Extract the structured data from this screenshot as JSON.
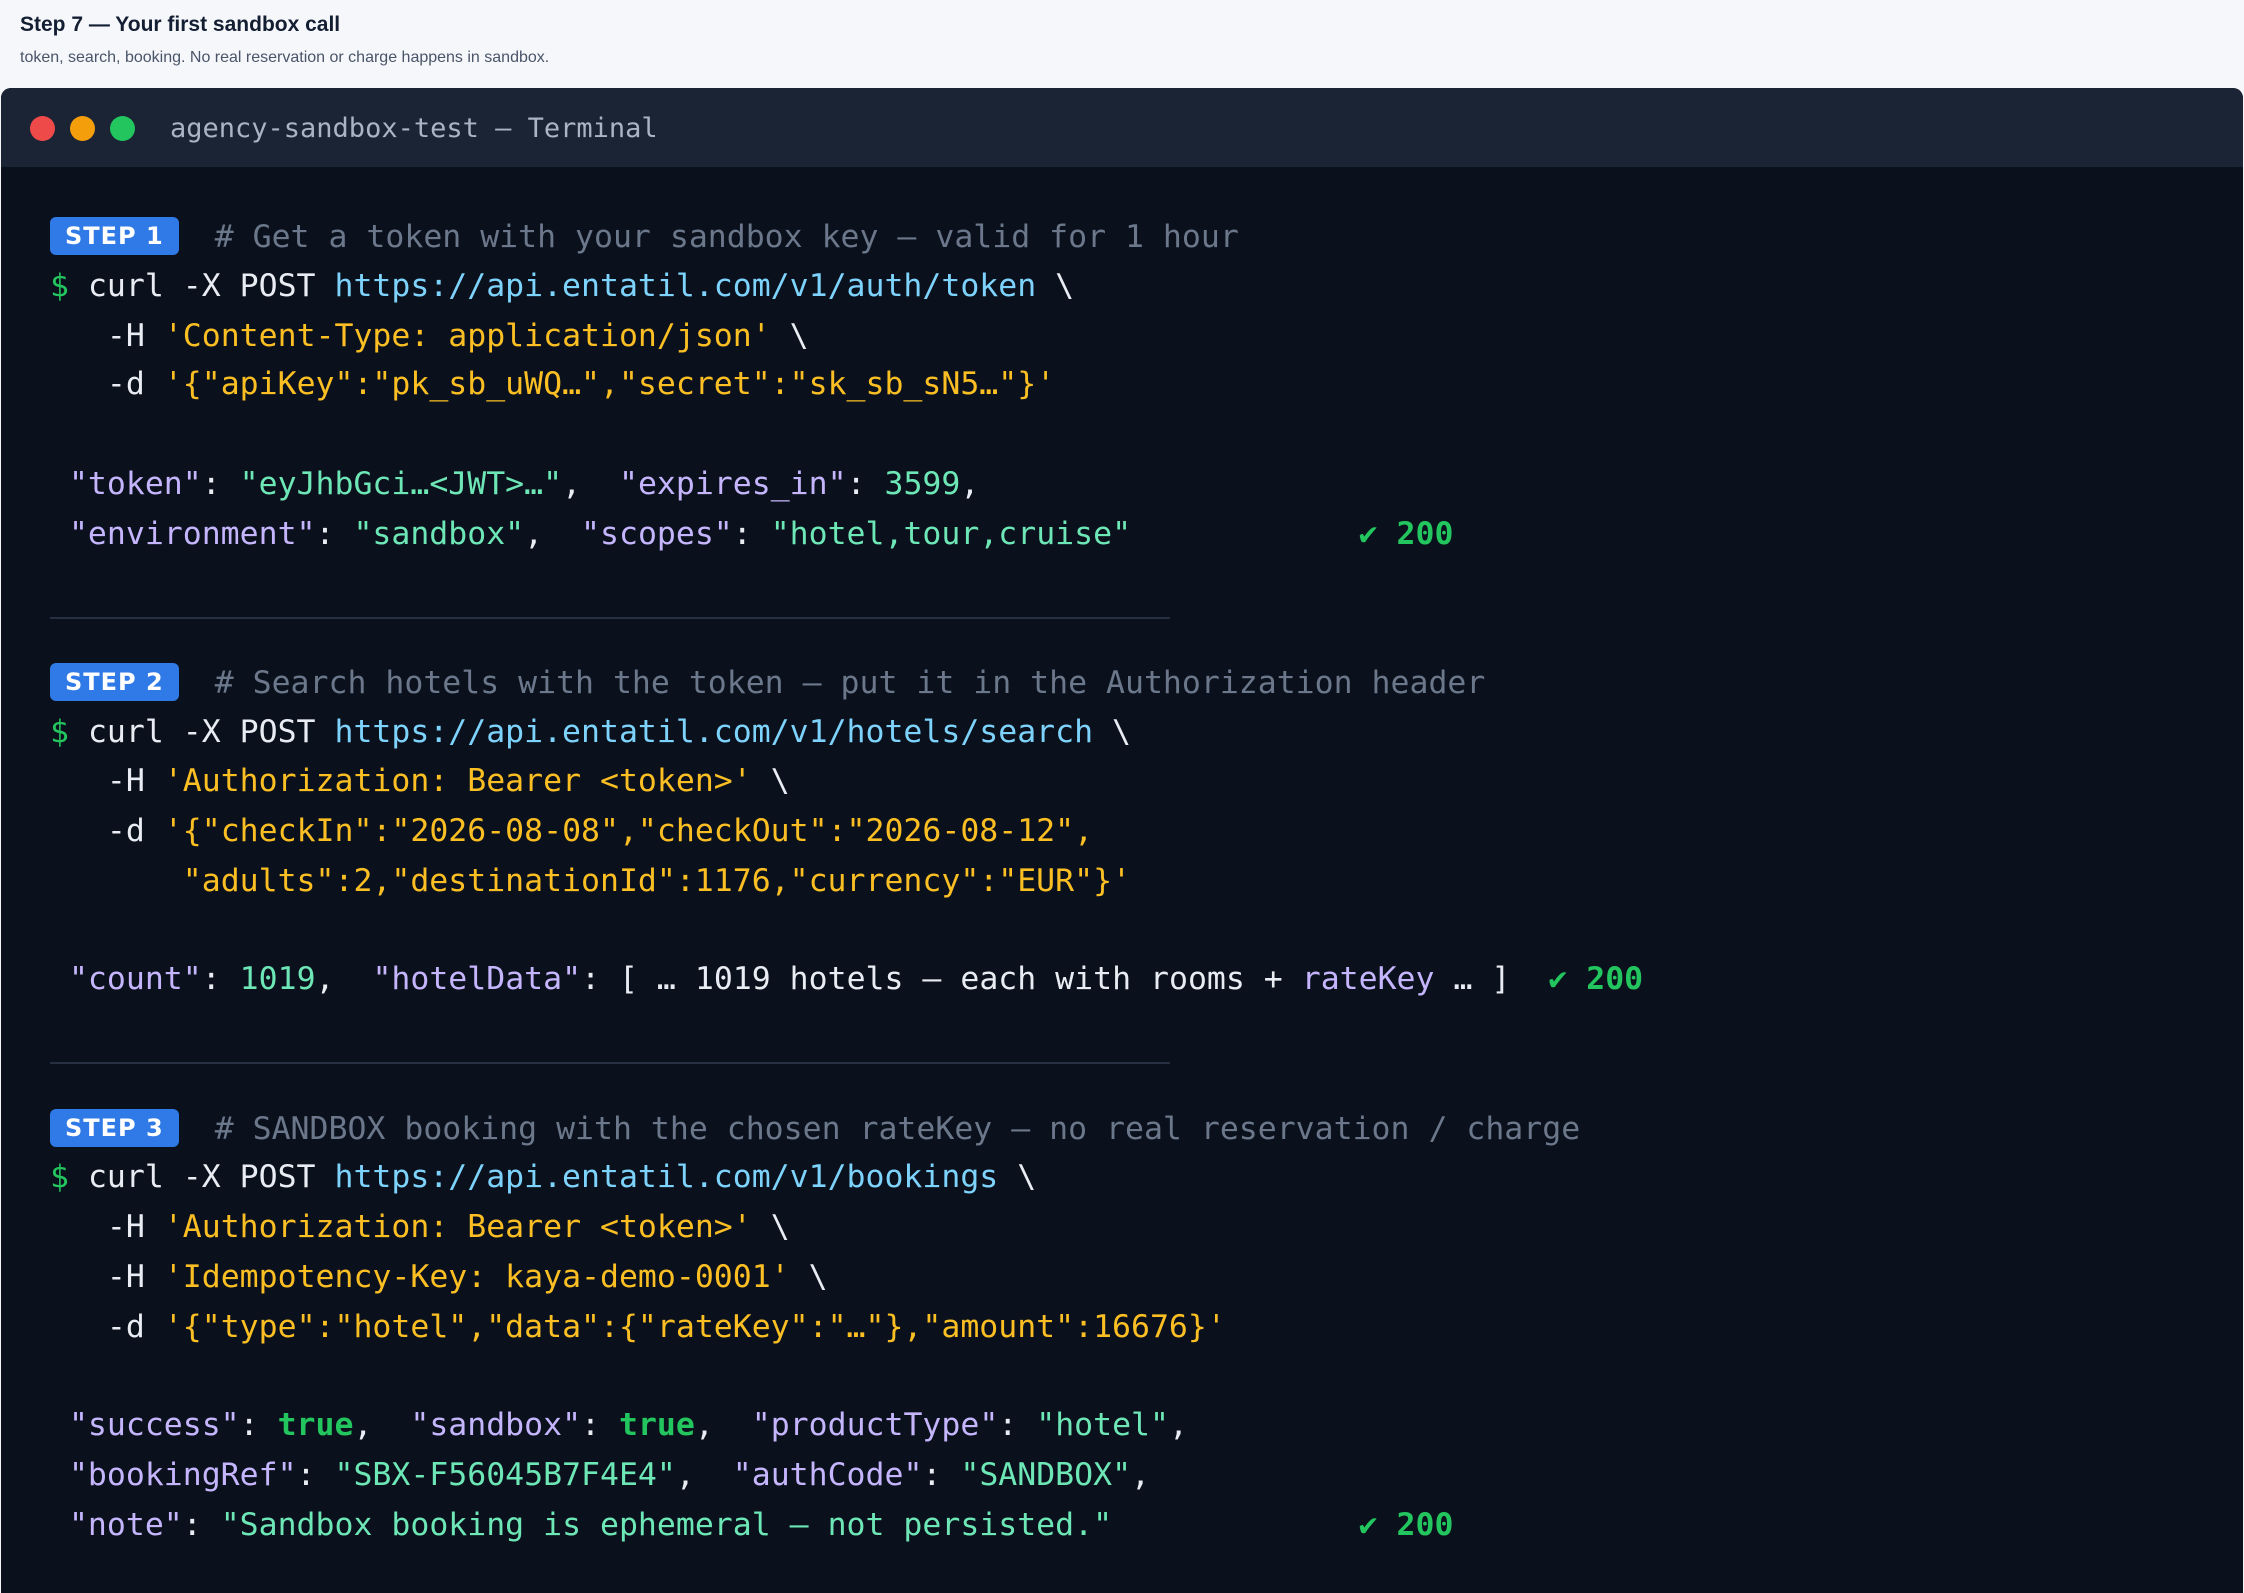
{
  "header": {
    "title": "Step 7 — Your first sandbox call",
    "subtitle": "token, search, booking. No real reservation or charge happens in sandbox."
  },
  "terminal": {
    "title": "agency-sandbox-test — Terminal"
  },
  "steps": [
    {
      "badge": "STEP 1",
      "comment": "# Get a token with your sandbox key — valid for 1 hour",
      "command": {
        "prompt": "$",
        "cmd": "curl -X POST",
        "url": "https://api.entatil.com/v1/auth/token",
        "cont": "\\",
        "opt1_flag": "-H",
        "opt1_value": "'Content-Type: application/json'",
        "opt2_flag": "-d",
        "opt2_value": "'{\"apiKey\":\"pk_sb_uWQ…\",\"secret\":\"sk_sb_sN5…\"}'"
      },
      "response": {
        "k_token": "\"token\"",
        "v_token": "\"eyJhbGci…<JWT>…\"",
        "k_expires": "\"expires_in\"",
        "v_expires": "3599",
        "k_env": "\"environment\"",
        "v_env": "\"sandbox\"",
        "k_scopes": "\"scopes\"",
        "v_scopes": "\"hotel,tour,cruise\"",
        "status": "✔ 200"
      }
    },
    {
      "badge": "STEP 2",
      "comment": "# Search hotels with the token — put it in the Authorization header",
      "command": {
        "prompt": "$",
        "cmd": "curl -X POST",
        "url": "https://api.entatil.com/v1/hotels/search",
        "cont": "\\",
        "opt1_flag": "-H",
        "opt1_value": "'Authorization: Bearer <token>'",
        "opt2_flag": "-d",
        "opt2_value": "'{\"checkIn\":\"2026-08-08\",\"checkOut\":\"2026-08-12\",",
        "opt2_value_cont": "\"adults\":2,\"destinationId\":1176,\"currency\":\"EUR\"}'"
      },
      "response": {
        "k_count": "\"count\"",
        "v_count": "1019",
        "k_hotel": "\"hotelData\"",
        "v_hotel_pre": "[ … 1019 hotels — each with rooms + ",
        "v_hotel_key": "rateKey",
        "v_hotel_post": " … ]",
        "status": "✔ 200"
      }
    },
    {
      "badge": "STEP 3",
      "comment": "# SANDBOX booking with the chosen rateKey — no real reservation / charge",
      "command": {
        "prompt": "$",
        "cmd": "curl -X POST",
        "url": "https://api.entatil.com/v1/bookings",
        "cont": "\\",
        "opt1_flag": "-H",
        "opt1_value": "'Authorization: Bearer <token>'",
        "opt2_flag": "-H",
        "opt2_value": "'Idempotency-Key: kaya-demo-0001'",
        "opt3_flag": "-d",
        "opt3_value": "'{\"type\":\"hotel\",\"data\":{\"rateKey\":\"…\"},\"amount\":16676}'"
      },
      "response": {
        "k_success": "\"success\"",
        "v_success": "true",
        "k_sandbox": "\"sandbox\"",
        "v_sandbox": "true",
        "k_ptype": "\"productType\"",
        "v_ptype": "\"hotel\"",
        "k_ref": "\"bookingRef\"",
        "v_ref": "\"SBX-F56045B7F4E4\"",
        "k_auth": "\"authCode\"",
        "v_auth": "\"SANDBOX\"",
        "k_note": "\"note\"",
        "v_note": "\"Sandbox booking is ephemeral — not persisted.\"",
        "status": "✔ 200"
      }
    }
  ]
}
